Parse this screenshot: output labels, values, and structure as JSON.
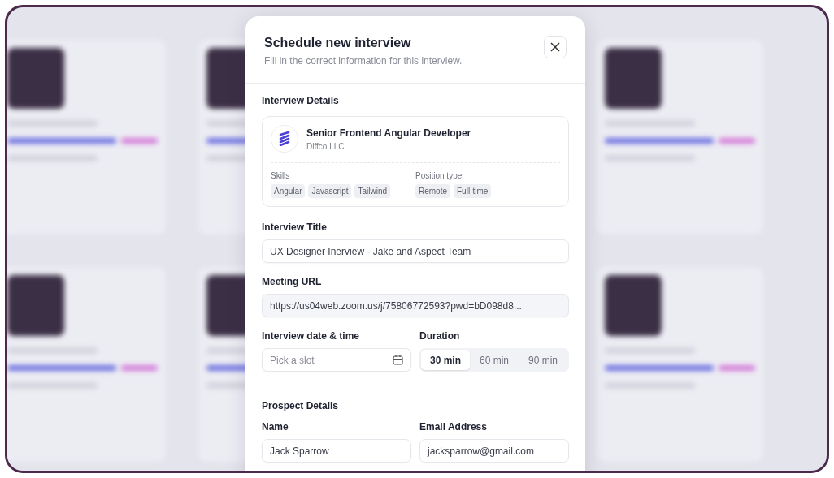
{
  "modal": {
    "title": "Schedule new interview",
    "subtitle": "Fill in the correct information for this interview."
  },
  "interview_details": {
    "heading": "Interview Details",
    "job_title": "Senior Frontend Angular Developer",
    "company": "Diffco LLC",
    "skills_label": "Skills",
    "skills": [
      "Angular",
      "Javascript",
      "Tailwind"
    ],
    "position_type_label": "Position type",
    "position_types": [
      "Remote",
      "Full-time"
    ]
  },
  "interview_title": {
    "label": "Interview Title",
    "value": "UX Designer Inerview - Jake and Aspect Team"
  },
  "meeting_url": {
    "label": "Meeting URL",
    "value": "https://us04web.zoom.us/j/75806772593?pwd=bD098d8..."
  },
  "date_time": {
    "label": "Interview date & time",
    "placeholder": "Pick a slot"
  },
  "duration": {
    "label": "Duration",
    "options": [
      {
        "label": "30 min",
        "selected": true
      },
      {
        "label": "60 min",
        "selected": false
      },
      {
        "label": "90 min",
        "selected": false
      }
    ]
  },
  "prospect": {
    "heading": "Prospect Details",
    "name": {
      "label": "Name",
      "value": "Jack Sparrow"
    },
    "email": {
      "label": "Email Address",
      "value": "jacksparrow@gmail.com"
    }
  }
}
